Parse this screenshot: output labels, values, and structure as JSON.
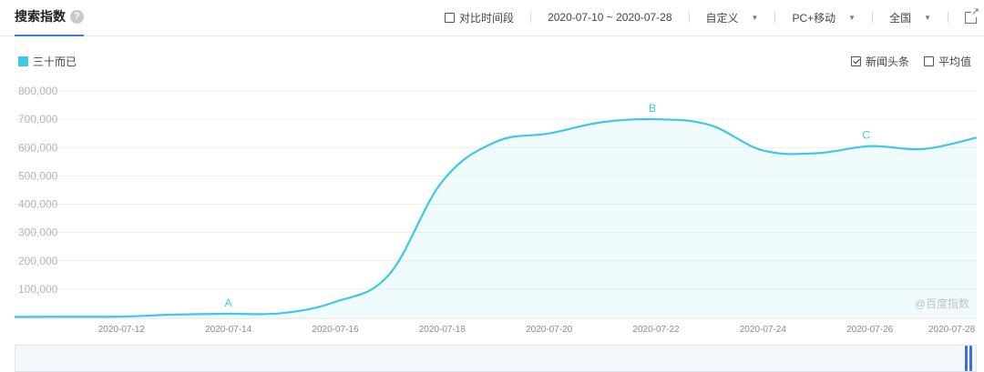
{
  "header": {
    "title": "搜索指数",
    "help_icon": "question-circle-icon",
    "compare_label": "对比时间段",
    "date_range": "2020-07-10 ~ 2020-07-28",
    "custom_label": "自定义",
    "device_label": "PC+移动",
    "region_label": "全国",
    "export_icon": "external-link-icon"
  },
  "legend": {
    "series_name": "三十而已",
    "color": "#3ec7e8"
  },
  "options": {
    "news_label": "新闻头条",
    "news_checked": true,
    "avg_label": "平均值",
    "avg_checked": false
  },
  "watermark": "@百度指数",
  "chart_data": {
    "type": "area",
    "ylim": [
      0,
      800000
    ],
    "yticks": [
      "800,000",
      "700,000",
      "600,000",
      "500,000",
      "400,000",
      "300,000",
      "200,000",
      "100,000"
    ],
    "xticks": [
      "2020-07-12",
      "2020-07-14",
      "2020-07-16",
      "2020-07-18",
      "2020-07-20",
      "2020-07-22",
      "2020-07-24",
      "2020-07-26",
      "2020-07-28"
    ],
    "x": [
      "2020-07-10",
      "2020-07-11",
      "2020-07-12",
      "2020-07-13",
      "2020-07-14",
      "2020-07-15",
      "2020-07-16",
      "2020-07-17",
      "2020-07-18",
      "2020-07-19",
      "2020-07-20",
      "2020-07-21",
      "2020-07-22",
      "2020-07-23",
      "2020-07-24",
      "2020-07-25",
      "2020-07-26",
      "2020-07-27",
      "2020-07-28"
    ],
    "series": [
      {
        "name": "三十而已",
        "values": [
          2000,
          2500,
          3000,
          10000,
          13000,
          15000,
          55000,
          150000,
          480000,
          620000,
          650000,
          690000,
          700000,
          680000,
          590000,
          580000,
          605000,
          595000,
          635000
        ]
      }
    ],
    "annotations": [
      {
        "label": "A",
        "x": "2020-07-14",
        "value": 13000
      },
      {
        "label": "B",
        "x": "2020-07-22",
        "value": 700000
      },
      {
        "label": "C",
        "x": "2020-07-26",
        "value": 605000
      }
    ],
    "grid": true,
    "legend_position": "top-left"
  }
}
